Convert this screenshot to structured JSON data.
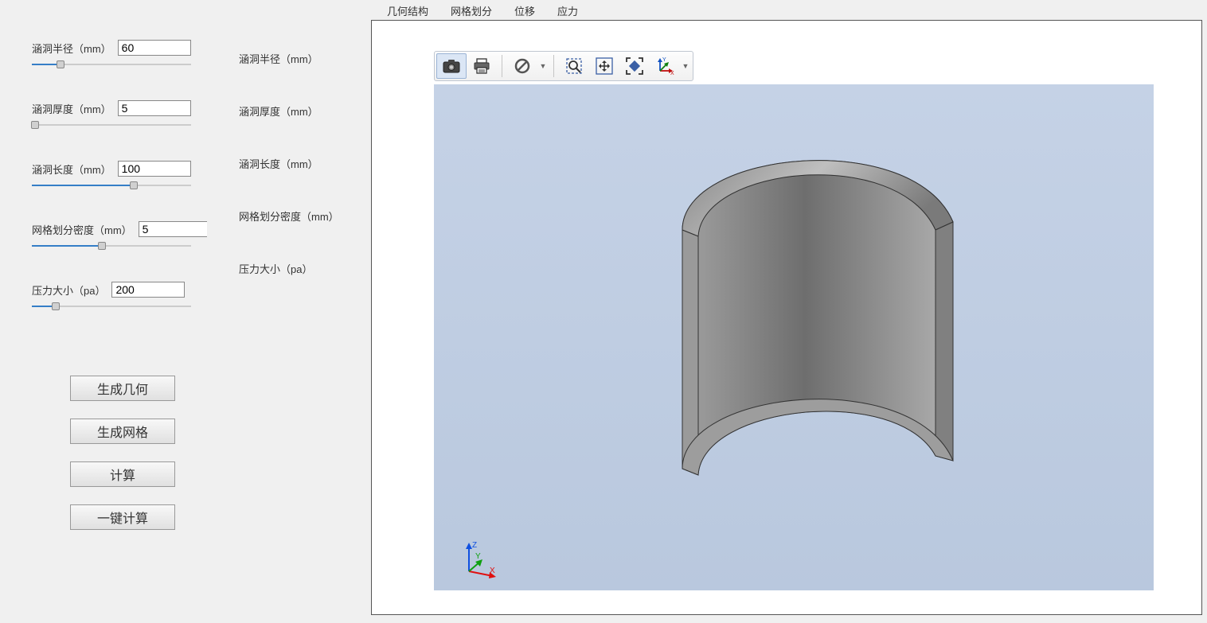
{
  "params": {
    "radius": {
      "label": "涵洞半径（mm）",
      "value": "60",
      "slider_percent": 18
    },
    "thickness": {
      "label": "涵洞厚度（mm）",
      "value": "5",
      "slider_percent": 2
    },
    "length": {
      "label": "涵洞长度（mm）",
      "value": "100",
      "slider_percent": 64
    },
    "mesh": {
      "label": "网格划分密度（mm）",
      "value": "5",
      "slider_percent": 44
    },
    "pressure": {
      "label": "压力大小（pa）",
      "value": "200",
      "slider_percent": 15
    }
  },
  "readouts": {
    "radius": "涵洞半径（mm）",
    "thickness": "涵洞厚度（mm）",
    "length": "涵洞长度（mm）",
    "mesh": "网格划分密度（mm）",
    "pressure": "压力大小（pa）"
  },
  "buttons": {
    "gen_geo": "生成几何",
    "gen_mesh": "生成网格",
    "compute": "计算",
    "one_click": "一键计算"
  },
  "tabs": [
    "几何结构",
    "网格划分",
    "位移",
    "应力"
  ],
  "toolbar_icons": [
    "camera-icon",
    "print-icon",
    "nobounds-icon",
    "zoom-box-icon",
    "pan-icon",
    "fit-icon",
    "axis-orient-icon"
  ],
  "axis_labels": {
    "x": "X",
    "y": "Y",
    "z": "Z"
  }
}
